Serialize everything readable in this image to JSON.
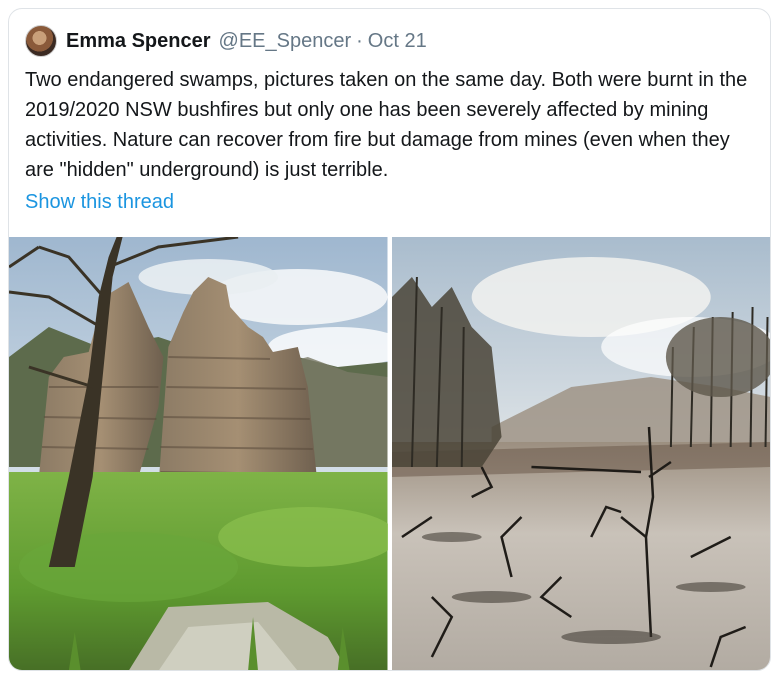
{
  "tweet": {
    "author_name": "Emma Spencer",
    "handle": "@EE_Spencer",
    "separator": "·",
    "date": "Oct 21",
    "text": "Two endangered swamps, pictures taken on the same day. Both were burnt in the 2019/2020 NSW bushfires but only one has been severely affected by mining activities. Nature can recover from fire but damage from mines (even when they are \"hidden\" underground) is just terrible.",
    "thread_link": "Show this thread"
  },
  "media": {
    "photos": [
      {
        "subject": "green swamp with sandstone rock pagoda"
      },
      {
        "subject": "dried burnt swamp with blackened stems"
      }
    ]
  },
  "colors": {
    "link": "#1b95e0",
    "secondary_text": "#657786",
    "border": "#dfe3e7"
  }
}
